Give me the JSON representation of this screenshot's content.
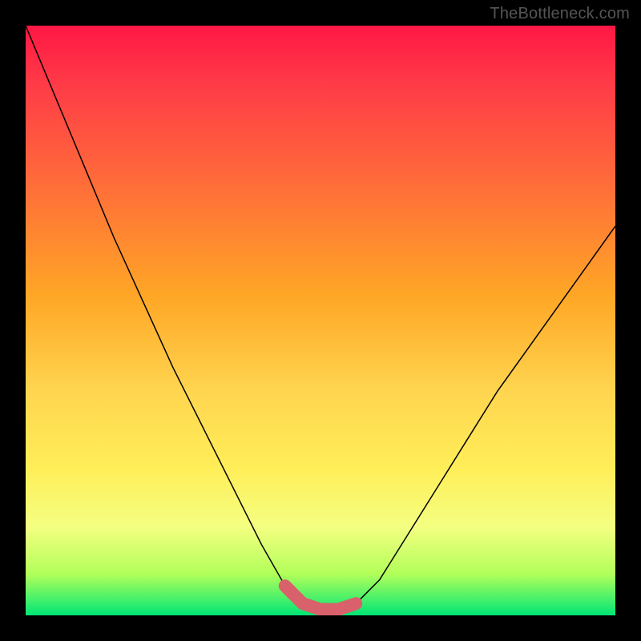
{
  "watermark": "TheBottleneck.com",
  "chart_data": {
    "type": "line",
    "title": "",
    "xlabel": "",
    "ylabel": "",
    "xlim": [
      0,
      100
    ],
    "ylim": [
      0,
      100
    ],
    "series": [
      {
        "name": "bottleneck-curve",
        "x": [
          0,
          5,
          10,
          15,
          20,
          25,
          30,
          35,
          40,
          44,
          47,
          50,
          53,
          56,
          60,
          65,
          70,
          75,
          80,
          85,
          90,
          95,
          100
        ],
        "y": [
          100,
          88,
          76,
          64,
          53,
          42,
          32,
          22,
          12,
          5,
          2,
          1,
          1,
          2,
          6,
          14,
          22,
          30,
          38,
          45,
          52,
          59,
          66
        ]
      }
    ],
    "accent_segment": {
      "name": "optimal-range",
      "color": "#d9616b",
      "x": [
        44,
        47,
        50,
        53,
        56
      ],
      "y": [
        5,
        2,
        1,
        1,
        2
      ]
    },
    "background_gradient": {
      "top": "#ff1744",
      "middle": "#ffee58",
      "bottom": "#00e676"
    }
  }
}
